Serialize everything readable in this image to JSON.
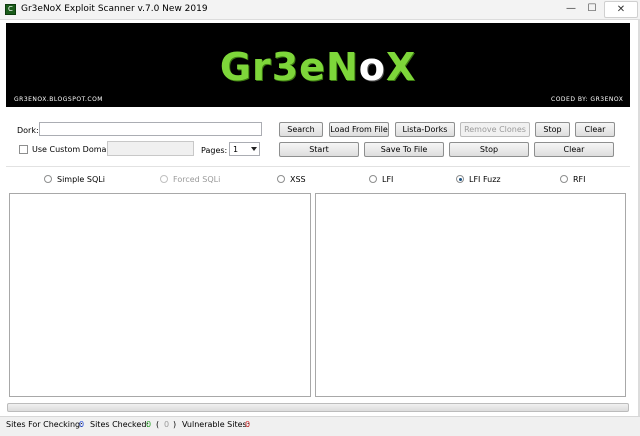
{
  "window": {
    "title": "Gr3eNoX Exploit Scanner v.7.0 New 2019",
    "app_icon": "C",
    "minimize_glyph": "—",
    "maximize_glyph": "☐",
    "close_glyph": "✕"
  },
  "banner": {
    "logo_part1": "Gr3eN",
    "logo_part2": "o",
    "logo_part3": "X",
    "site": "GR3ENOX.BLOGSPOT.COM",
    "coded_by": "CODED BY: GR3ENOX",
    "logo_color": "#7ed63a"
  },
  "form": {
    "dork_label": "Dork:",
    "dork_value": "",
    "custom_domain_label": "Use Custom Domain:",
    "custom_domain_value": "",
    "pages_label": "Pages:",
    "pages_value": "1",
    "buttons": {
      "search": "Search",
      "load_from_file": "Load From File",
      "lista_dorks": "Lista-Dorks",
      "remove_clones": "Remove Clones",
      "stop_top": "Stop",
      "clear_top": "Clear",
      "start": "Start",
      "save_to_file": "Save To File",
      "stop": "Stop",
      "clear": "Clear"
    }
  },
  "scan_types": {
    "options": [
      "Simple SQLi",
      "Forced SQLi",
      "XSS",
      "LFI",
      "LFI Fuzz",
      "RFI"
    ],
    "selected": "LFI Fuzz"
  },
  "status": {
    "sites_for_checking_label": "Sites For Checking:",
    "sites_for_checking": "0",
    "sites_checked_label": "Sites Checked:",
    "sites_checked": "0",
    "paren_open": "(",
    "paren_value": "0",
    "paren_close": ")",
    "vulnerable_label": "Vulnerable Sites:",
    "vulnerable": "0",
    "color_checking": "#2a4fd6",
    "color_checked": "#2aa52a",
    "color_vuln": "#d62a2a"
  }
}
